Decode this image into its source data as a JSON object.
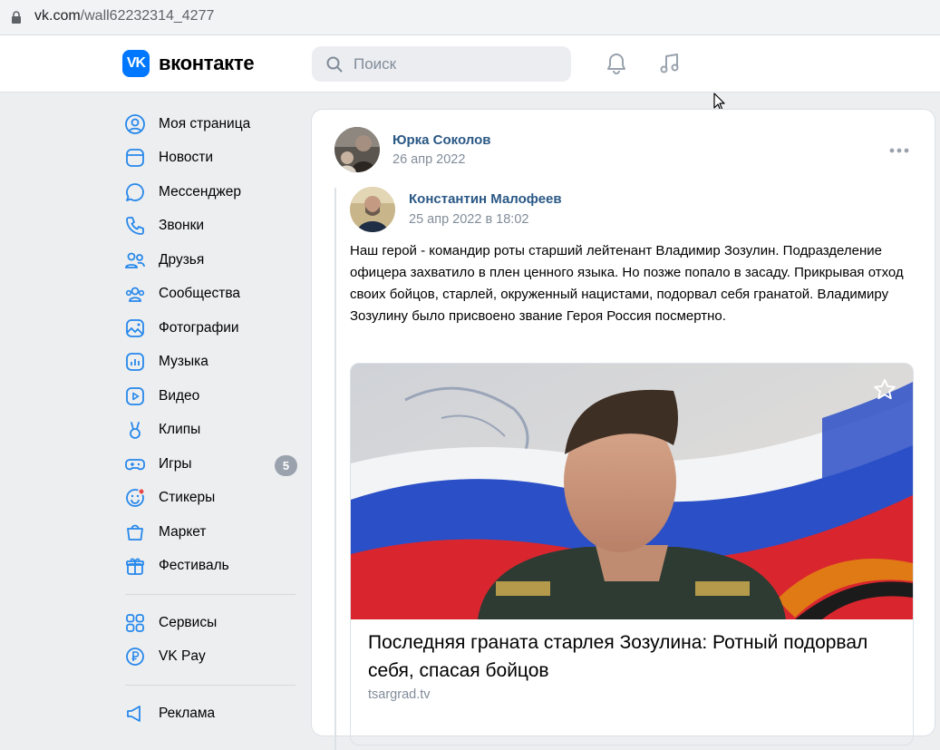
{
  "browser": {
    "url_host": "vk.com",
    "url_path": "/wall62232314_4277"
  },
  "header": {
    "logo_mark": "VK",
    "logo_text": "вконтакте",
    "search_placeholder": "Поиск",
    "icons": [
      "search-icon",
      "bell-icon",
      "music-icon"
    ],
    "accent_color": "#0077ff"
  },
  "nav": {
    "items": [
      {
        "label": "Моя страница",
        "icon": "user-icon"
      },
      {
        "label": "Новости",
        "icon": "news-icon"
      },
      {
        "label": "Мессенджер",
        "icon": "chat-icon"
      },
      {
        "label": "Звонки",
        "icon": "phone-icon"
      },
      {
        "label": "Друзья",
        "icon": "friends-icon"
      },
      {
        "label": "Сообщества",
        "icon": "groups-icon"
      },
      {
        "label": "Фотографии",
        "icon": "photo-icon"
      },
      {
        "label": "Музыка",
        "icon": "music-icon"
      },
      {
        "label": "Видео",
        "icon": "video-icon"
      },
      {
        "label": "Клипы",
        "icon": "clips-icon"
      },
      {
        "label": "Игры",
        "icon": "games-icon",
        "badge": "5"
      },
      {
        "label": "Стикеры",
        "icon": "stickers-icon"
      },
      {
        "label": "Маркет",
        "icon": "market-icon"
      },
      {
        "label": "Фестиваль",
        "icon": "gift-icon"
      }
    ],
    "services": [
      {
        "label": "Сервисы",
        "icon": "services-icon"
      },
      {
        "label": "VK Pay",
        "icon": "vkpay-icon"
      }
    ],
    "ads": [
      {
        "label": "Реклама",
        "icon": "megaphone-icon"
      }
    ]
  },
  "post": {
    "author": "Юрка Соколов",
    "date": "26 апр 2022",
    "repost": {
      "author": "Константин Малофеев",
      "date": "25 апр 2022 в 18:02",
      "text": "Наш герой - командир роты старший лейтенант Владимир Зозулин. Подразделение офицера захватило в плен ценного языка. Но позже попало в засаду. Прикрывая отход своих бойцов, старлей, окруженный нацистами, подорвал себя гранатой. Владимиру Зозулину было присвоено звание Героя Россия посмертно."
    },
    "link": {
      "title": "Последняя граната старлея Зозулина: Ротный подорвал себя, спасая бойцов",
      "domain": "tsargrad.tv"
    }
  }
}
